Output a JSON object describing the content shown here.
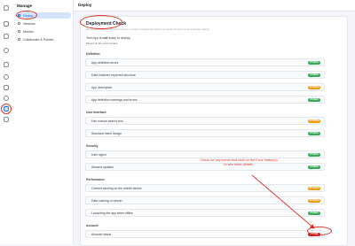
{
  "sidebar": {
    "title": "Manage",
    "items": [
      {
        "label": "Deploy",
        "selected": true
      },
      {
        "label": "Versions",
        "selected": false
      },
      {
        "label": "Monitor",
        "selected": false
      },
      {
        "label": "Collaborate & Publish",
        "selected": false
      }
    ]
  },
  "header": {
    "title": "Deploy"
  },
  "card": {
    "title": "Deployment Check",
    "subtitle": "Run a quick check on your app to ensure it is ready for deployment before you deploy the app in a live production setting.",
    "status_prefix": "Test App is",
    "status_bold": "not",
    "status_suffix": "ready to deploy.",
    "note": "Please fix the errors below."
  },
  "sections": {
    "definition": "Definition",
    "ui": "User Interface",
    "security": "Security",
    "performance": "Performance",
    "account": "Account"
  },
  "rows": {
    "def_errors": {
      "label": "App definition errors",
      "badge": "PASSED"
    },
    "def_struct": {
      "label": "Data matches expected structure",
      "badge": "PASSED"
    },
    "def_desc": {
      "label": "App description",
      "badge": "WARNING"
    },
    "def_warn": {
      "label": "App definition warnings and errors",
      "badge": "PASSED"
    },
    "ui_icon": {
      "label": "Use custom launch icon",
      "badge": "WARNING"
    },
    "ui_menu": {
      "label": "Standard menu design",
      "badge": "PASSED"
    },
    "sec_signin": {
      "label": "User signin",
      "badge": "PASSED"
    },
    "sec_updates": {
      "label": "Allowed updates",
      "badge": "PASSED"
    },
    "perf_cache": {
      "label": "Content caching on the mobile device",
      "badge": "WARNING"
    },
    "perf_server": {
      "label": "Data caching on server",
      "badge": "WARNING"
    },
    "perf_offline": {
      "label": "Launching the app when offline",
      "badge": "PASSED"
    },
    "acct_status": {
      "label": "Account status",
      "badge": "ERROR"
    }
  },
  "annotation": "Check for any errors and click on the Error button(s) to see more details.",
  "colors": {
    "passed": "#34a853",
    "warning": "#f29900",
    "error": "#c5221f",
    "annotation": "#d93025"
  }
}
